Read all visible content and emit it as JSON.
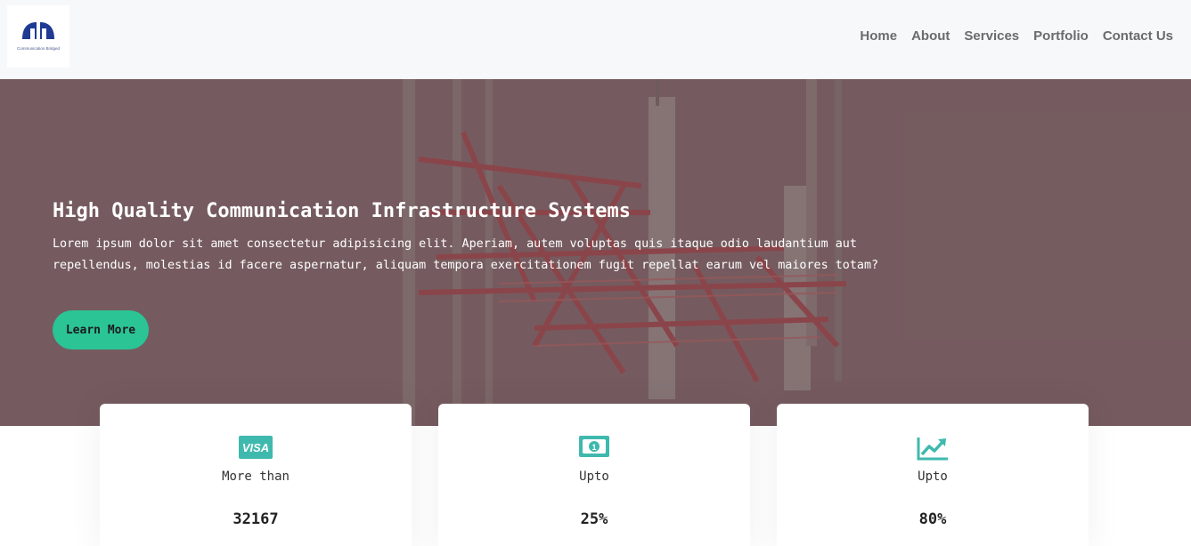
{
  "header": {
    "logo_text": "Communication Bridged",
    "nav": [
      "Home",
      "About",
      "Services",
      "Portfolio",
      "Contact Us"
    ]
  },
  "hero": {
    "title": "High Quality Communication Infrastructure Systems",
    "text": "Lorem ipsum dolor sit amet consectetur adipisicing elit. Aperiam, autem voluptas quis itaque odio laudantium aut repellendus, molestias id facere aspernatur, aliquam tempora exercitationem fugit repellat earum vel maiores totam?",
    "button_label": "Learn More"
  },
  "stats": [
    {
      "icon": "visa-card-icon",
      "label": "More than",
      "value": "32167"
    },
    {
      "icon": "money-bill-icon",
      "label": "Upto",
      "value": "25%"
    },
    {
      "icon": "chart-line-icon",
      "label": "Upto",
      "value": "80%"
    }
  ],
  "colors": {
    "accent": "#2bc495",
    "icon": "#3fb9ad",
    "hero_overlay": "#6e585b",
    "header_bg": "#f7f8fa",
    "logo_blue": "#1f3a93"
  }
}
